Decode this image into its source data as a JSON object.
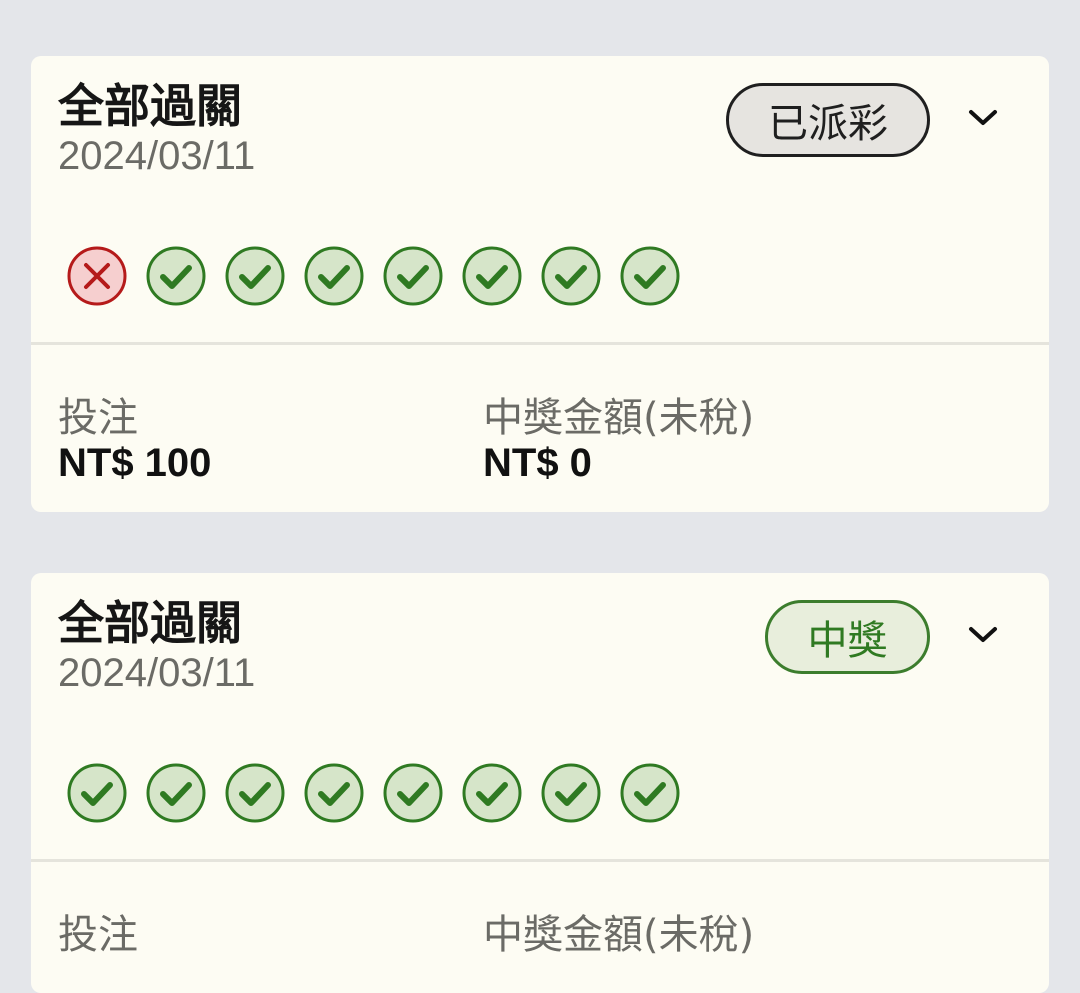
{
  "bets": [
    {
      "title": "全部過關",
      "date": "2024/03/11",
      "status": "已派彩",
      "status_colors": {
        "bg": "#e6e4e0",
        "border": "#1f1f1f",
        "text": "#1f1f1f"
      },
      "legs": [
        "lost",
        "won",
        "won",
        "won",
        "won",
        "won",
        "won",
        "won"
      ],
      "stake_label": "投注",
      "stake_value": "NT$ 100",
      "payout_label": "中獎金額(未稅)",
      "payout_value": "NT$ 0"
    },
    {
      "title": "全部過關",
      "date": "2024/03/11",
      "status": "中獎",
      "status_colors": {
        "bg": "#e8eedc",
        "border": "#3c7d2d",
        "text": "#2f7a22"
      },
      "legs": [
        "won",
        "won",
        "won",
        "won",
        "won",
        "won",
        "won",
        "won"
      ],
      "stake_label": "投注",
      "payout_label": "中獎金額(未稅)"
    }
  ],
  "icons": {
    "won": "check-circle-icon",
    "lost": "x-circle-icon",
    "expand": "chevron-down-icon"
  },
  "colors": {
    "won_fill": "#d6e5c9",
    "won_stroke": "#2f7a22",
    "lost_fill": "#f6cfcf",
    "lost_stroke": "#b51a1a",
    "card_bg": "#fdfcf3",
    "page_bg": "#e4e6ea"
  }
}
